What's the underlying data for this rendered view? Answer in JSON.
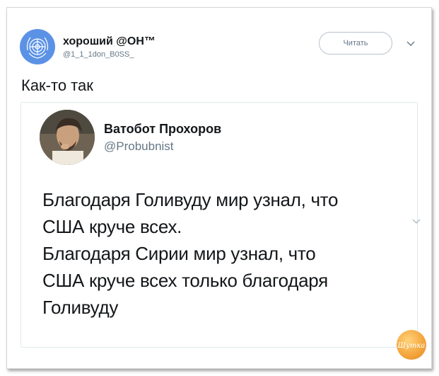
{
  "tweet": {
    "author_name": "хороший @ОН™",
    "author_handle": "@1_1_1don_B0SS_",
    "follow_label": "Читать",
    "text": "Как-то так"
  },
  "quote": {
    "author_name": "Ватобот Прохоров",
    "author_handle": "@Probubnist",
    "lines": [
      "Благодаря Голивуду мир узнал, что",
      "США круче всех.",
      "Благодаря Сирии мир узнал, что",
      "США круче всех только благодаря",
      "Голивуду"
    ]
  },
  "watermark": {
    "text": "Шутка"
  },
  "colors": {
    "text": "#14171a",
    "secondary": "#657786",
    "border": "#e1e8ed",
    "un_blue": "#5b92e5",
    "watermark_orange": "#f3a33a"
  },
  "icons": [
    "un-emblem-avatar",
    "chevron-down-icon",
    "profile-photo-avatar",
    "watermark-logo"
  ]
}
